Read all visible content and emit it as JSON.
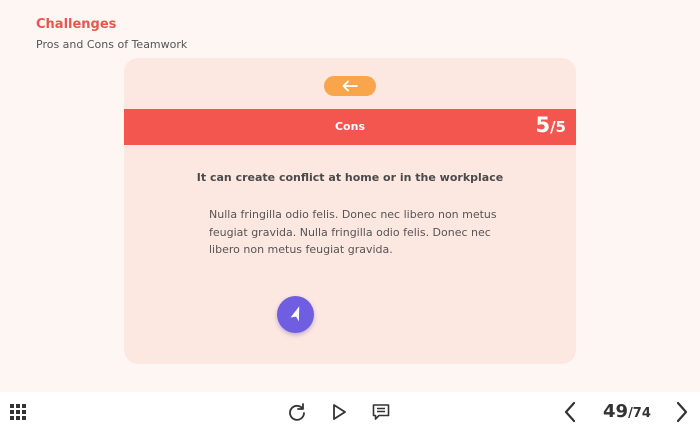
{
  "header": {
    "title": "Challenges",
    "subtitle": "Pros and Cons of Teamwork"
  },
  "card": {
    "back_icon": "arrow-left-icon",
    "band_label": "Cons",
    "counter": {
      "current": "5",
      "total": "/5"
    },
    "heading": "It can create conflict at home or in the workplace",
    "body": "Nulla fringilla odio felis. Donec nec libero non metus feugiat gravida. Nulla fringilla odio felis. Donec nec libero non metus feugiat gravida.",
    "nav_icon": "navigation-arrow-icon"
  },
  "toolbar": {
    "menu_icon": "grid-menu-icon",
    "replay_icon": "replay-icon",
    "play_icon": "play-icon",
    "notes_icon": "notes-icon",
    "prev_icon": "chevron-left-icon",
    "next_icon": "chevron-right-icon",
    "page_current": "49",
    "page_total": "/74"
  },
  "colors": {
    "accent": "#f2564e",
    "title": "#e8574f",
    "pill": "#f8a54c",
    "nav_button": "#6f5fe0",
    "card_bg": "#fde7e1"
  }
}
